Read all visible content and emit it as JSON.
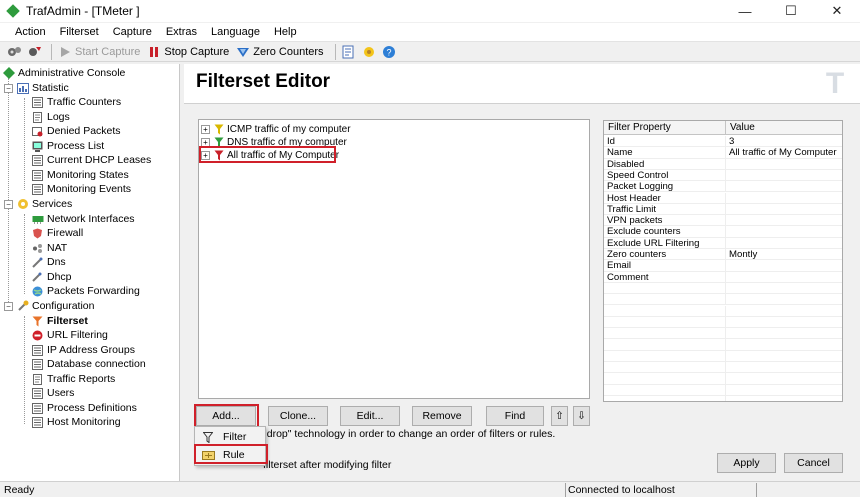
{
  "window": {
    "title": "TrafAdmin - [TMeter ]",
    "minimize": "—",
    "maximize": "☐",
    "close": "✕"
  },
  "menu": [
    "Action",
    "Filterset",
    "Capture",
    "Extras",
    "Language",
    "Help"
  ],
  "toolbar": {
    "start_capture": "Start Capture",
    "stop_capture": "Stop Capture",
    "zero_counters": "Zero Counters"
  },
  "tree": {
    "root": "Administrative Console",
    "statistic": {
      "label": "Statistic",
      "items": [
        "Traffic Counters",
        "Logs",
        "Denied Packets",
        "Process List",
        "Current DHCP Leases",
        "Monitoring States",
        "Monitoring Events"
      ]
    },
    "services": {
      "label": "Services",
      "items": [
        "Network Interfaces",
        "Firewall",
        "NAT",
        "Dns",
        "Dhcp",
        "Packets Forwarding"
      ]
    },
    "configuration": {
      "label": "Configuration",
      "items": [
        "Filterset",
        "URL Filtering",
        "IP Address Groups",
        "Database connection",
        "Traffic Reports",
        "Users",
        "Process Definitions",
        "Host Monitoring"
      ]
    }
  },
  "editor": {
    "title": "Filterset Editor",
    "logo": "T",
    "filters": [
      "ICMP traffic of my computer",
      "DNS traffic of my computer",
      "All traffic of My Computer"
    ],
    "grid": {
      "headers": [
        "Filter Property",
        "Value"
      ],
      "rows": [
        [
          "Id",
          "3"
        ],
        [
          "Name",
          "All traffic of My Computer"
        ],
        [
          "Disabled",
          ""
        ],
        [
          "Speed Control",
          ""
        ],
        [
          "Packet Logging",
          ""
        ],
        [
          "Host Header",
          ""
        ],
        [
          "Traffic Limit",
          ""
        ],
        [
          "VPN packets",
          ""
        ],
        [
          "Exclude counters",
          ""
        ],
        [
          "Exclude URL Filtering",
          ""
        ],
        [
          "Zero counters",
          "Montly"
        ],
        [
          "Email",
          ""
        ],
        [
          "Comment",
          ""
        ]
      ]
    },
    "buttons": {
      "add": "Add...",
      "clone": "Clone...",
      "edit": "Edit...",
      "remove": "Remove",
      "find": "Find",
      "up": "⇧",
      "down": "⇩",
      "apply": "Apply",
      "cancel": "Cancel"
    },
    "hint": "d drop\" technology in order to change an order of filters or rules.",
    "checkbox_label": "filterset after modifying filter",
    "popup": [
      "Filter",
      "Rule"
    ]
  },
  "status": {
    "left": "Ready",
    "right": "Connected to localhost"
  },
  "colors": {
    "highlight": "#d0202a",
    "filter_green": "#2e9b3d",
    "filter_yellow": "#d9b800",
    "filter_red": "#c8202a"
  }
}
